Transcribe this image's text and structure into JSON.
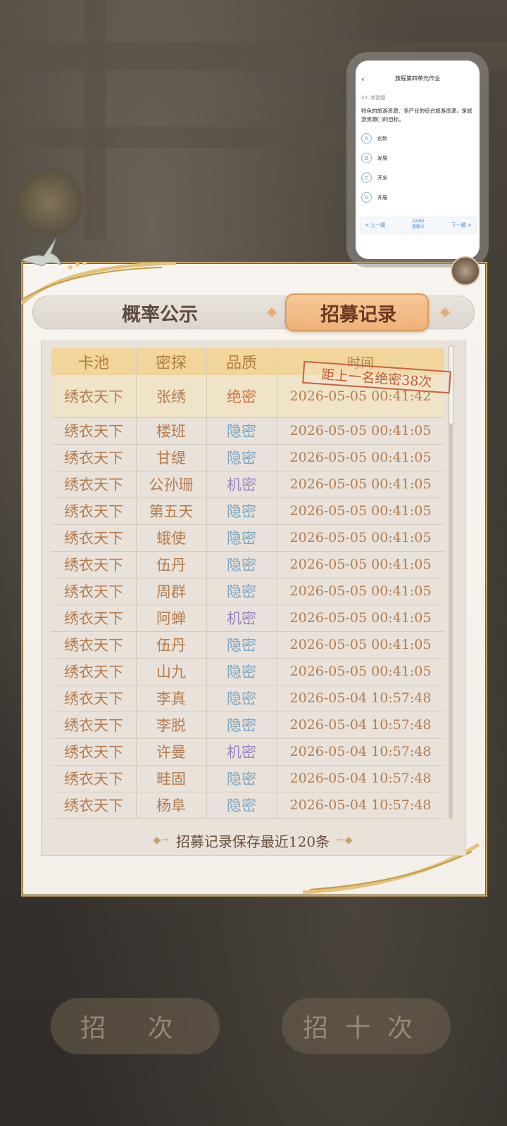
{
  "tabs": {
    "probability": "概率公示",
    "records": "招募记录"
  },
  "table": {
    "headers": [
      "卡池",
      "密探",
      "品质",
      "时间"
    ],
    "rows": [
      {
        "pool": "绣衣天下",
        "name": "张绣",
        "quality": "绝密",
        "q": "jue",
        "time": "2026-05-05 00:41:42"
      },
      {
        "pool": "绣衣天下",
        "name": "楼班",
        "quality": "隐密",
        "q": "hid",
        "time": "2026-05-05 00:41:05"
      },
      {
        "pool": "绣衣天下",
        "name": "甘缇",
        "quality": "隐密",
        "q": "hid",
        "time": "2026-05-05 00:41:05"
      },
      {
        "pool": "绣衣天下",
        "name": "公孙珊",
        "quality": "机密",
        "q": "ji",
        "time": "2026-05-05 00:41:05"
      },
      {
        "pool": "绣衣天下",
        "name": "第五天",
        "quality": "隐密",
        "q": "hid",
        "time": "2026-05-05 00:41:05"
      },
      {
        "pool": "绣衣天下",
        "name": "蛾使",
        "quality": "隐密",
        "q": "hid",
        "time": "2026-05-05 00:41:05"
      },
      {
        "pool": "绣衣天下",
        "name": "伍丹",
        "quality": "隐密",
        "q": "hid",
        "time": "2026-05-05 00:41:05"
      },
      {
        "pool": "绣衣天下",
        "name": "周群",
        "quality": "隐密",
        "q": "hid",
        "time": "2026-05-05 00:41:05"
      },
      {
        "pool": "绣衣天下",
        "name": "阿蝉",
        "quality": "机密",
        "q": "ji",
        "time": "2026-05-05 00:41:05"
      },
      {
        "pool": "绣衣天下",
        "name": "伍丹",
        "quality": "隐密",
        "q": "hid",
        "time": "2026-05-05 00:41:05"
      },
      {
        "pool": "绣衣天下",
        "name": "山九",
        "quality": "隐密",
        "q": "hid",
        "time": "2026-05-05 00:41:05"
      },
      {
        "pool": "绣衣天下",
        "name": "李真",
        "quality": "隐密",
        "q": "hid",
        "time": "2026-05-04 10:57:48"
      },
      {
        "pool": "绣衣天下",
        "name": "李脱",
        "quality": "隐密",
        "q": "hid",
        "time": "2026-05-04 10:57:48"
      },
      {
        "pool": "绣衣天下",
        "name": "许曼",
        "quality": "机密",
        "q": "ji",
        "time": "2026-05-04 10:57:48"
      },
      {
        "pool": "绣衣天下",
        "name": "畦固",
        "quality": "隐密",
        "q": "hid",
        "time": "2026-05-04 10:57:48"
      },
      {
        "pool": "绣衣天下",
        "name": "杨阜",
        "quality": "隐密",
        "q": "hid",
        "time": "2026-05-04 10:57:48"
      }
    ],
    "stamp": "距上一名绝密38次"
  },
  "footer_note": "招募记录保存最近120条",
  "colors": {
    "hidden": "#7fa6c0",
    "secret": "#9b84c2",
    "top_secret": "#d2703c",
    "text": "#b57c4f"
  },
  "floating_window": {
    "back_icon": "chevron-left-icon",
    "title": "旅程第四单元作业",
    "question_number": "22. 单选题",
    "question": "特色的旅游资源、多产业的综合旅游资源，是旅游资源(    )的目标。",
    "options": [
      {
        "letter": "A",
        "text": "创新"
      },
      {
        "letter": "B",
        "text": "发展"
      },
      {
        "letter": "C",
        "text": "开发"
      },
      {
        "letter": "D",
        "text": "开展"
      }
    ],
    "prev": "< 上一题",
    "page": "22/60",
    "card": "答题卡",
    "next": "下一题 >"
  },
  "bottom_buttons": [
    "招 次",
    "招十次"
  ]
}
